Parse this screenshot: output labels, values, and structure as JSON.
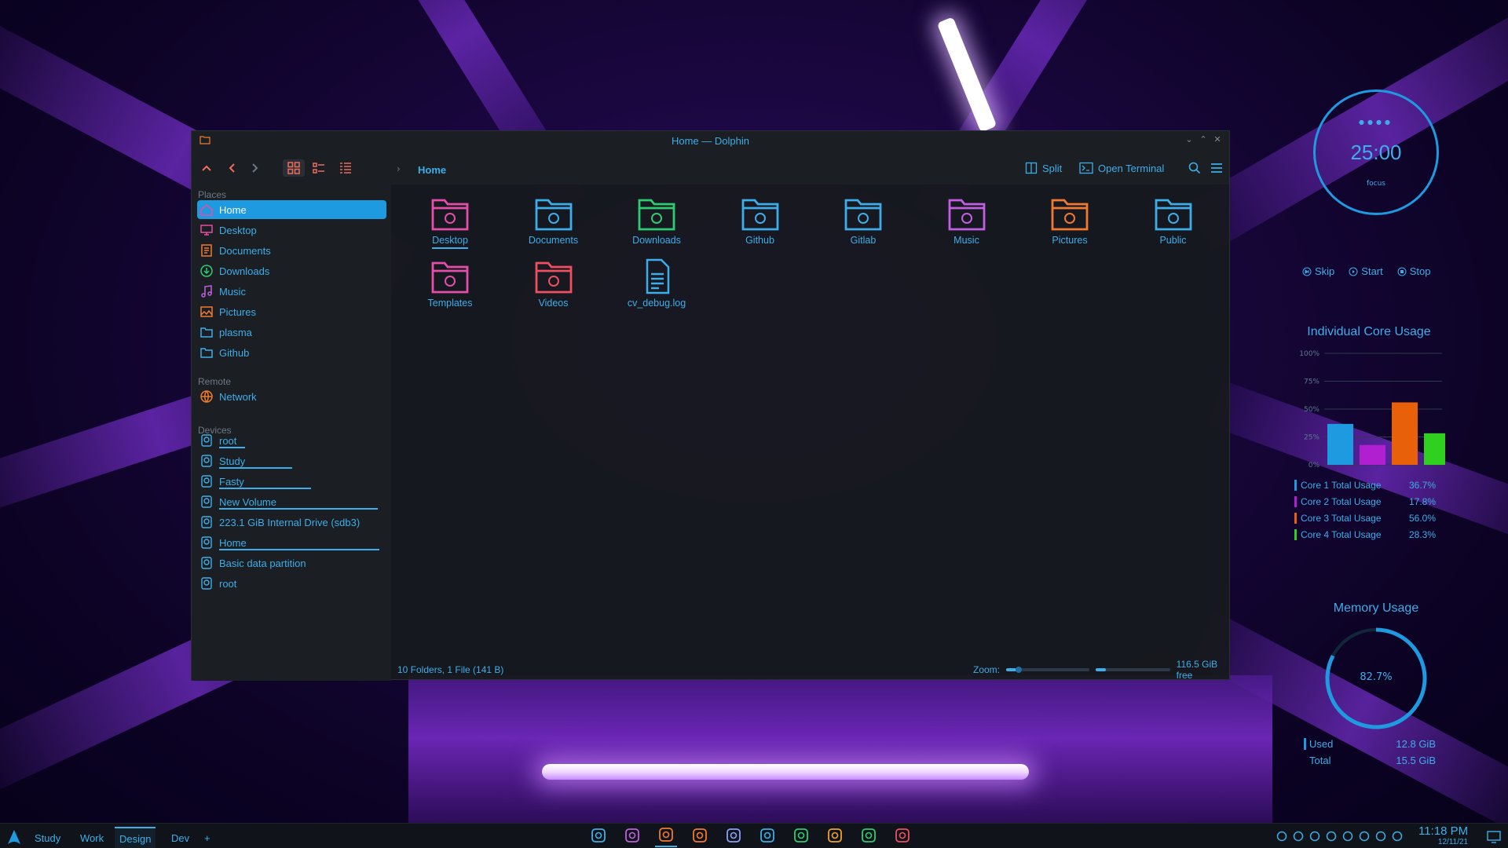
{
  "window": {
    "title": "Home — Dolphin"
  },
  "toolbar": {
    "split_label": "Split",
    "terminal_label": "Open Terminal",
    "breadcrumb_current": "Home"
  },
  "sidebar": {
    "places_header": "Places",
    "places": [
      {
        "label": "Home",
        "icon": "home-icon",
        "active": true
      },
      {
        "label": "Desktop",
        "icon": "desktop-icon"
      },
      {
        "label": "Documents",
        "icon": "documents-icon"
      },
      {
        "label": "Downloads",
        "icon": "downloads-icon"
      },
      {
        "label": "Music",
        "icon": "music-icon"
      },
      {
        "label": "Pictures",
        "icon": "pictures-icon"
      },
      {
        "label": "plasma",
        "icon": "folder-icon"
      },
      {
        "label": "Github",
        "icon": "folder-icon"
      }
    ],
    "remote_header": "Remote",
    "remote": [
      {
        "label": "Network",
        "icon": "network-icon"
      }
    ],
    "devices_header": "Devices",
    "devices": [
      {
        "label": "root",
        "usage": 0.16
      },
      {
        "label": "Study",
        "usage": 0.45
      },
      {
        "label": "Fasty",
        "usage": 0.57
      },
      {
        "label": "New Volume",
        "usage": 0.98
      },
      {
        "label": "223.1 GiB Internal Drive (sdb3)",
        "usage": 0.0
      },
      {
        "label": "Home",
        "usage": 0.99
      },
      {
        "label": "Basic data partition",
        "usage": 0.0
      },
      {
        "label": "root",
        "usage": 0.0
      }
    ]
  },
  "files": [
    {
      "name": "Desktop",
      "icon": "desktop-folder-icon",
      "color": "#e44ea8"
    },
    {
      "name": "Documents",
      "icon": "documents-folder-icon",
      "color": "#3daee9"
    },
    {
      "name": "Downloads",
      "icon": "downloads-folder-icon",
      "color": "#2ecc71"
    },
    {
      "name": "Github",
      "icon": "folder-icon",
      "color": "#3daee9"
    },
    {
      "name": "Gitlab",
      "icon": "folder-icon",
      "color": "#3daee9"
    },
    {
      "name": "Music",
      "icon": "music-folder-icon",
      "color": "#c060e0"
    },
    {
      "name": "Pictures",
      "icon": "pictures-folder-icon",
      "color": "#f07a30"
    },
    {
      "name": "Public",
      "icon": "public-folder-icon",
      "color": "#3daee9"
    },
    {
      "name": "Templates",
      "icon": "templates-folder-icon",
      "color": "#e44ea8"
    },
    {
      "name": "Videos",
      "icon": "videos-folder-icon",
      "color": "#ed5060"
    },
    {
      "name": "cv_debug.log",
      "icon": "text-file-icon",
      "color": "#3daee9"
    }
  ],
  "statusbar": {
    "summary": "10 Folders, 1 File (141 B)",
    "zoom_label": "Zoom:",
    "free": "116.5 GiB free",
    "zoom_level": 0.15,
    "free_fraction": 0.14
  },
  "pomodoro": {
    "time": "25:00",
    "mode": "focus",
    "skip": "Skip",
    "start": "Start",
    "stop": "Stop"
  },
  "cpu_widget": {
    "title": "Individual Core Usage",
    "legend": [
      {
        "label": "Core 1 Total Usage",
        "value": "36.7%",
        "color": "#1d9ae0"
      },
      {
        "label": "Core 2 Total Usage",
        "value": "17.8%",
        "color": "#b020d0"
      },
      {
        "label": "Core 3 Total Usage",
        "value": "56.0%",
        "color": "#e8600a"
      },
      {
        "label": "Core 4 Total Usage",
        "value": "28.3%",
        "color": "#30d020"
      }
    ]
  },
  "chart_data": {
    "type": "bar",
    "categories": [
      "Core 1 Total Usage",
      "Core 2 Total Usage",
      "Core 3 Total Usage",
      "Core 4 Total Usage"
    ],
    "values": [
      36.7,
      17.8,
      56.0,
      28.3
    ],
    "title": "Individual Core Usage",
    "ylim": [
      0,
      100
    ],
    "yticks": [
      "0%",
      "25%",
      "50%",
      "75%",
      "100%"
    ],
    "colors": [
      "#1d9ae0",
      "#b020d0",
      "#e8600a",
      "#30d020"
    ]
  },
  "memory_widget": {
    "title": "Memory Usage",
    "percent": "82.7%",
    "fraction": 0.827,
    "used_label": "Used",
    "used_value": "12.8 GiB",
    "total_label": "Total",
    "total_value": "15.5 GiB"
  },
  "taskbar": {
    "desktops": [
      {
        "label": "Study"
      },
      {
        "label": "Work"
      },
      {
        "label": "Design",
        "active": true
      },
      {
        "label": "Dev"
      }
    ],
    "add_label": "+",
    "time": "11:18 PM",
    "date": "12/11/21",
    "apps": [
      "settings-icon",
      "store-icon",
      "files-icon",
      "brave-icon",
      "wps-icon",
      "chrome-icon",
      "spotify-icon",
      "chrome-alt-icon",
      "tablet-icon",
      "notes-icon"
    ]
  },
  "colors": {
    "accent": "#3daee9",
    "selection": "#1d9ae0",
    "window_bg": "#1b1e22"
  }
}
